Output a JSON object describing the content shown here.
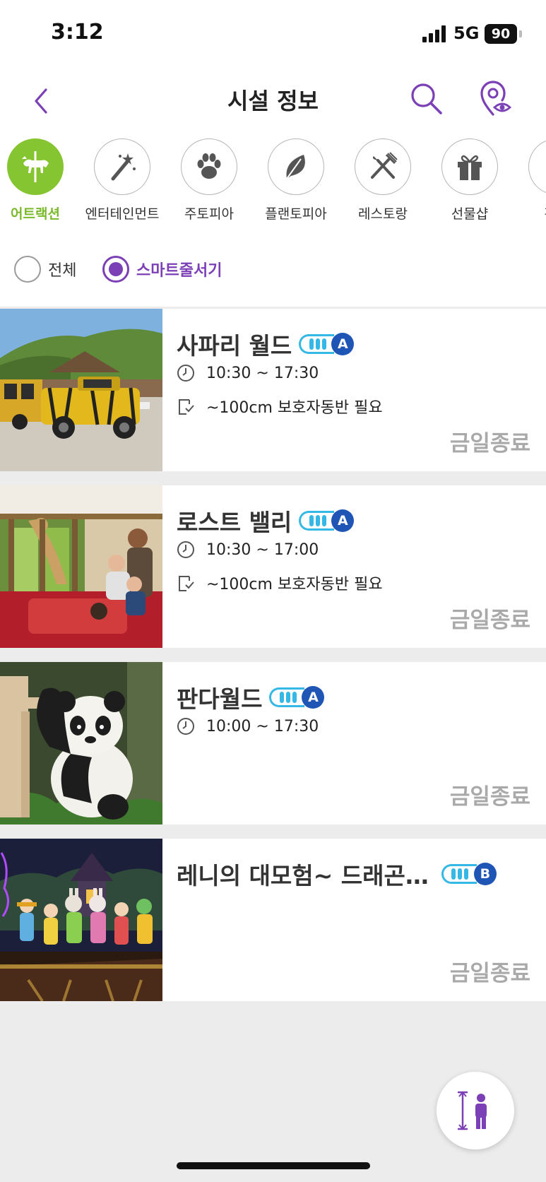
{
  "status_bar": {
    "time": "3:12",
    "network": "5G",
    "battery": "90"
  },
  "header": {
    "title": "시설 정보"
  },
  "categories": [
    {
      "label": "어트랙션",
      "icon": "carousel-horse-icon",
      "active": true
    },
    {
      "label": "엔터테인먼트",
      "icon": "magic-wand-icon",
      "active": false
    },
    {
      "label": "주토피아",
      "icon": "paw-icon",
      "active": false
    },
    {
      "label": "플랜토피아",
      "icon": "leaf-icon",
      "active": false
    },
    {
      "label": "레스토랑",
      "icon": "fork-knife-icon",
      "active": false
    },
    {
      "label": "선물샵",
      "icon": "gift-icon",
      "active": false
    },
    {
      "label": "편의",
      "icon": "convenience-icon",
      "active": false
    }
  ],
  "filters": [
    {
      "label": "전체",
      "selected": false
    },
    {
      "label": "스마트줄서기",
      "selected": true
    }
  ],
  "facilities": [
    {
      "name": "사파리 월드",
      "badge": "A",
      "hours": "10:30 ~ 17:30",
      "requirement": "~100cm 보호자동반 필요",
      "status": "금일종료",
      "image": "safari-truck"
    },
    {
      "name": "로스트 밸리",
      "badge": "A",
      "hours": "10:30 ~ 17:00",
      "requirement": "~100cm 보호자동반 필요",
      "status": "금일종료",
      "image": "lost-valley-bus"
    },
    {
      "name": "판다월드",
      "badge": "A",
      "hours": "10:00 ~ 17:30",
      "status": "금일종료",
      "image": "panda"
    },
    {
      "name": "레니의 대모험~ 드래곤…",
      "badge": "B",
      "status": "금일종료",
      "image": "stage-show"
    }
  ],
  "colors": {
    "accent_purple": "#7b3fb6",
    "active_green": "#86c532",
    "badge_blue": "#35b8e6",
    "closed_gray": "#a9a9a9"
  }
}
